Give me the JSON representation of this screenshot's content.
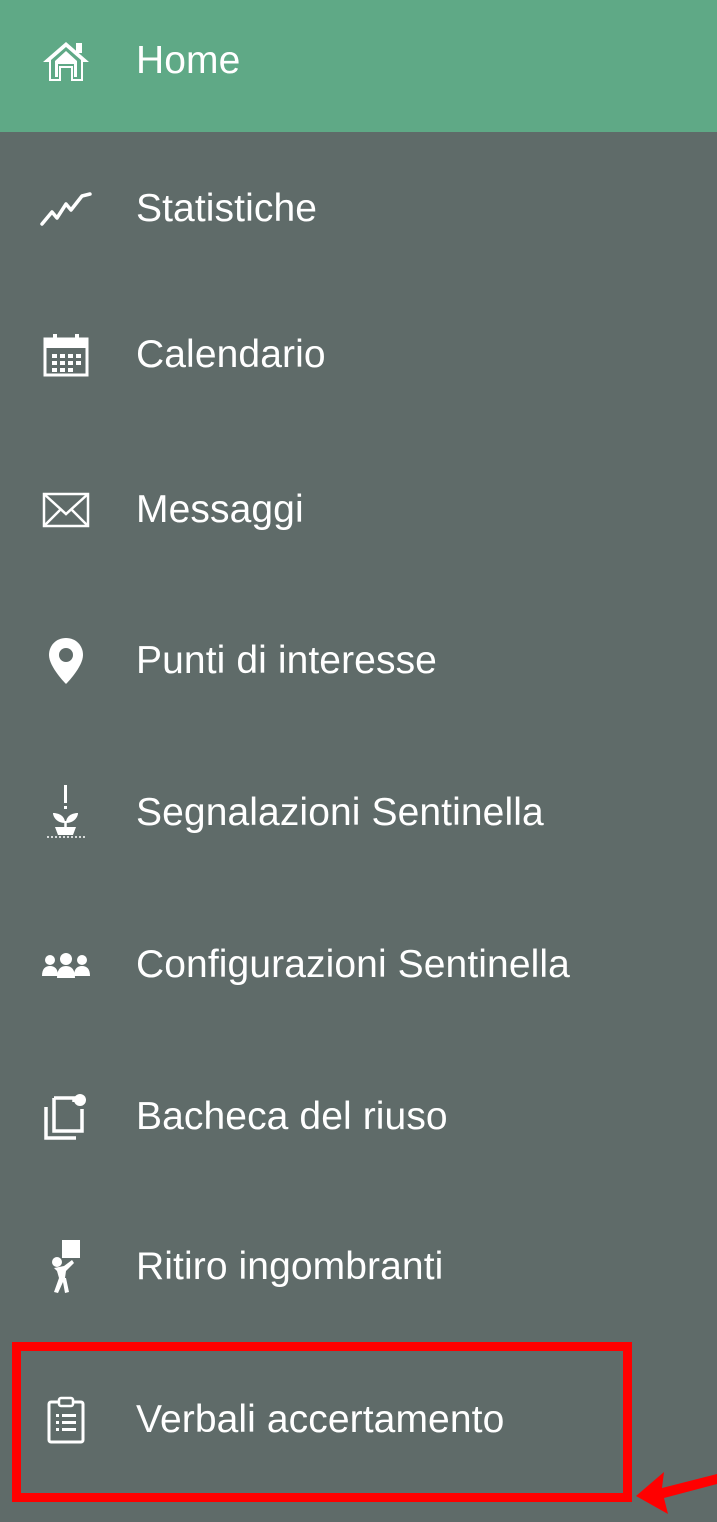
{
  "sidebar": {
    "items": [
      {
        "label": "Home",
        "icon": "home-icon",
        "active": true
      },
      {
        "label": "Statistiche",
        "icon": "chart-line-icon",
        "active": false
      },
      {
        "label": "Calendario",
        "icon": "calendar-icon",
        "active": false
      },
      {
        "label": "Messaggi",
        "icon": "envelope-icon",
        "active": false
      },
      {
        "label": "Punti di interesse",
        "icon": "map-pin-icon",
        "active": false
      },
      {
        "label": "Segnalazioni Sentinella",
        "icon": "plant-alert-icon",
        "active": false
      },
      {
        "label": "Configurazioni Sentinella",
        "icon": "users-group-icon",
        "active": false
      },
      {
        "label": "Bacheca del riuso",
        "icon": "copy-icon",
        "active": false
      },
      {
        "label": "Ritiro ingombranti",
        "icon": "person-carrying-icon",
        "active": false
      },
      {
        "label": "Verbali accertamento",
        "icon": "clipboard-list-icon",
        "active": false
      }
    ]
  },
  "annotation": {
    "highlighted_item": "Verbali accertamento",
    "color": "#ff0000"
  },
  "colors": {
    "sidebar_bg": "#5f6b69",
    "active_bg": "#5fa986",
    "text": "#ffffff"
  }
}
